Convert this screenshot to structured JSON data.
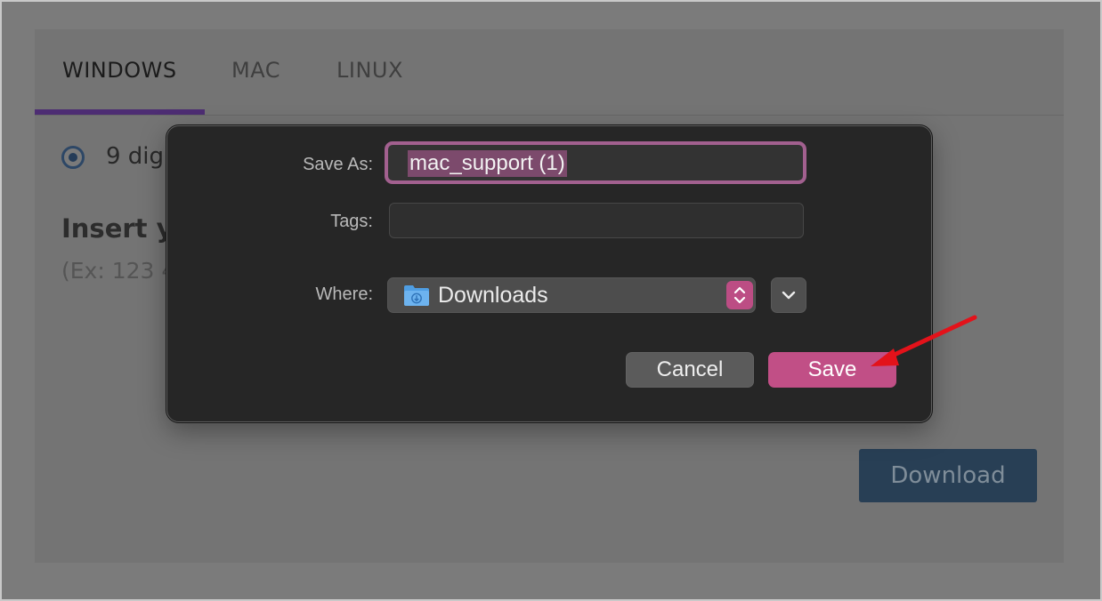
{
  "background_page": {
    "tabs": [
      {
        "label": "WINDOWS",
        "active": true
      },
      {
        "label": "MAC",
        "active": false
      },
      {
        "label": "LINUX",
        "active": false
      }
    ],
    "radio_label": "9 digi",
    "insert_title": "Insert yo",
    "insert_hint": "(Ex: 123 4",
    "download_label": "Download"
  },
  "dialog": {
    "save_as_label": "Save As:",
    "save_as_value": "mac_support (1)",
    "tags_label": "Tags:",
    "tags_value": "",
    "where_label": "Where:",
    "where_value": "Downloads",
    "where_icon": "downloads-folder-icon",
    "cancel_label": "Cancel",
    "save_label": "Save"
  },
  "colors": {
    "accent": "#c14f86",
    "field_focus": "#a2608f",
    "annotation_arrow": "#e3121a"
  }
}
